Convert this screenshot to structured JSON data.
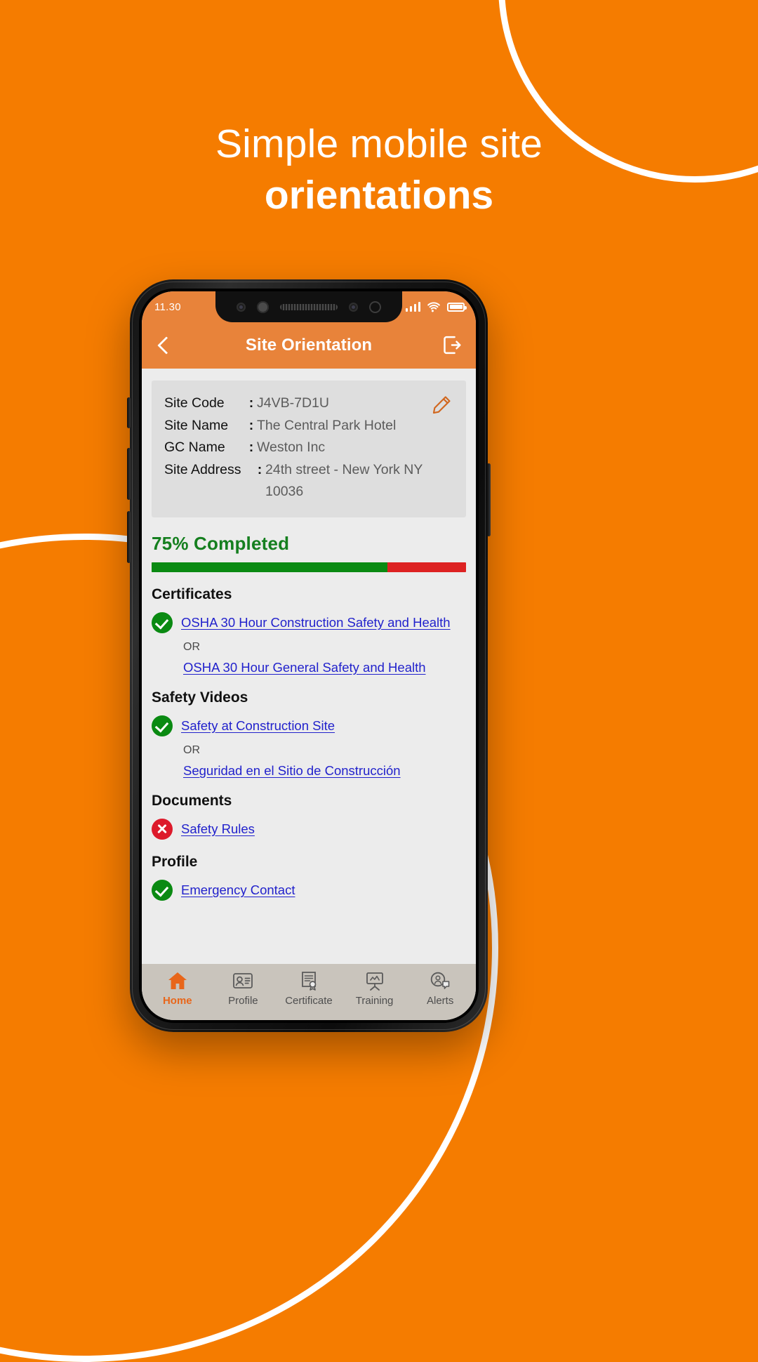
{
  "theme": {
    "brand_orange": "#F57C00",
    "header_orange": "#E8833A",
    "accent_green": "#0a8a12",
    "accent_red": "#dd1a2b",
    "link_blue": "#2222cc"
  },
  "headline": {
    "line1": "Simple mobile site",
    "line2": "orientations"
  },
  "status_bar": {
    "time": "11.30",
    "signal_icon": "signal-bars-icon",
    "wifi_icon": "wifi-icon",
    "battery_icon": "battery-icon"
  },
  "app_header": {
    "back_icon": "chevron-left-icon",
    "title": "Site Orientation",
    "logout_icon": "logout-icon"
  },
  "info_card": {
    "edit_icon": "pencil-icon",
    "rows": [
      {
        "label": "Site Code",
        "colon": ":",
        "value": "J4VB-7D1U"
      },
      {
        "label": "Site Name",
        "colon": ":",
        "value": "The Central Park Hotel"
      },
      {
        "label": "GC Name",
        "colon": ":",
        "value": "Weston Inc"
      },
      {
        "label": "Site Address",
        "colon": ":",
        "value": "24th street - New York NY 10036"
      }
    ]
  },
  "progress": {
    "label": "75% Completed",
    "percent": 75
  },
  "sections": [
    {
      "title": "Certificates",
      "items": [
        {
          "status": "ok",
          "text": "OSHA 30 Hour Construction Safety and Health",
          "indent": false
        },
        {
          "status": "none",
          "text": "OSHA 30 Hour General Safety and Health",
          "indent": true
        }
      ],
      "or_label": "OR"
    },
    {
      "title": "Safety Videos",
      "items": [
        {
          "status": "ok",
          "text": "Safety at Construction Site",
          "indent": false
        },
        {
          "status": "none",
          "text": "Seguridad en el Sitio de Construcción",
          "indent": true
        }
      ],
      "or_label": "OR"
    },
    {
      "title": "Documents",
      "items": [
        {
          "status": "no",
          "text": "Safety Rules",
          "indent": false
        }
      ],
      "or_label": ""
    },
    {
      "title": "Profile",
      "items": [
        {
          "status": "ok",
          "text": "Emergency Contact",
          "indent": false
        }
      ],
      "or_label": ""
    }
  ],
  "tabbar": {
    "items": [
      {
        "label": "Home",
        "icon": "home-icon",
        "active": true
      },
      {
        "label": "Profile",
        "icon": "id-card-icon",
        "active": false
      },
      {
        "label": "Certificate",
        "icon": "certificate-icon",
        "active": false
      },
      {
        "label": "Training",
        "icon": "training-icon",
        "active": false
      },
      {
        "label": "Alerts",
        "icon": "alerts-icon",
        "active": false
      }
    ]
  }
}
